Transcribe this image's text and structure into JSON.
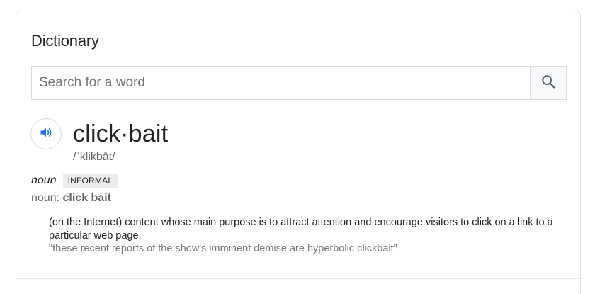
{
  "card": {
    "title": "Dictionary"
  },
  "search": {
    "placeholder": "Search for a word",
    "value": "",
    "icon": "search-icon"
  },
  "entry": {
    "pronounce_icon": "speaker-icon",
    "headword": "click·bait",
    "phonetic": "/ˈklikbāt/",
    "part_of_speech": "noun",
    "register": "INFORMAL",
    "forms_label": "noun:",
    "forms_value": "click bait",
    "definition": "(on the Internet) content whose main purpose is to attract attention and encourage visitors to click on a link to a particular web page.",
    "example": "\"these recent reports of the show's imminent demise are hyperbolic clickbait\""
  },
  "colors": {
    "speaker_blue": "#1a73e8",
    "muted_text": "#666666",
    "example_text": "#777777"
  }
}
